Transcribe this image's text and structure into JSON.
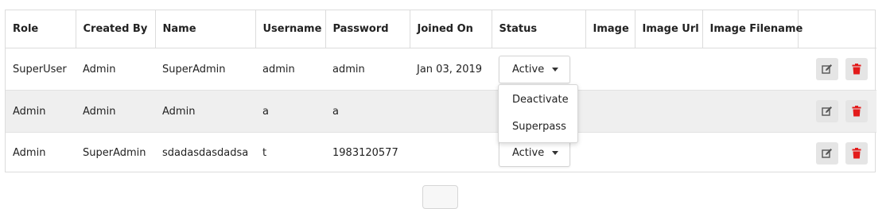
{
  "table": {
    "headers": [
      "Role",
      "Created By",
      "Name",
      "Username",
      "Password",
      "Joined On",
      "Status",
      "Image",
      "Image Url",
      "Image Filename",
      ""
    ],
    "rows": [
      {
        "role": "SuperUser",
        "created_by": "Admin",
        "name": "SuperAdmin",
        "username": "admin",
        "password": "admin",
        "joined_on": "Jan 03, 2019",
        "status": "Active"
      },
      {
        "role": "Admin",
        "created_by": "Admin",
        "name": "Admin",
        "username": "a",
        "password": "a",
        "joined_on": "",
        "status": ""
      },
      {
        "role": "Admin",
        "created_by": "SuperAdmin",
        "name": "sdadasdasdadsa",
        "username": "t",
        "password": "1983120577",
        "joined_on": "",
        "status": "Active"
      }
    ]
  },
  "status_dropdown": {
    "options": [
      "Deactivate",
      "Superpass"
    ]
  },
  "icons": {
    "edit": "edit-icon",
    "delete": "trash-icon",
    "caret": "caret-down-icon"
  },
  "colors": {
    "delete_red": "#e31b1b",
    "stripe": "#efefef"
  }
}
